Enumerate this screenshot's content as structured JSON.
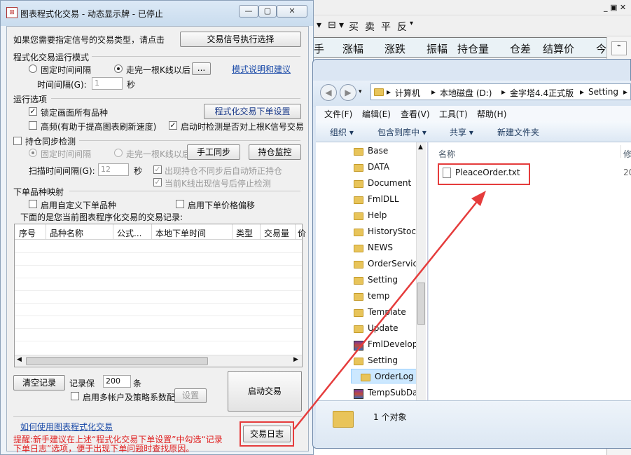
{
  "background_app": {
    "toolbar_items": [
      "买",
      "卖",
      "平",
      "反"
    ],
    "header_columns": [
      "手",
      "涨幅",
      "涨跌",
      "振幅",
      "持仓量",
      "仓差",
      "结算价",
      "今"
    ]
  },
  "main_window": {
    "title": "图表程式化交易 - 动态显示牌 - 已停止",
    "signal_prompt": "如果您需要指定信号的交易类型，请点击",
    "signal_button": "交易信号执行选择",
    "run_mode": {
      "label": "程式化交易运行模式",
      "fixed_interval": "固定时间间隔",
      "after_kline": "走完一根K线以后",
      "ellipsis_button": "...",
      "help_link": "模式说明和建议",
      "interval_label": "时间间隔(G):",
      "interval_value": "1",
      "interval_unit": "秒"
    },
    "run_options": {
      "label": "运行选项",
      "lock_all": "锁定画面所有品种",
      "order_settings_button": "程式化交易下单设置",
      "high_freq": "高频(有助于提高图表刷新速度)",
      "startup_check": "启动时检测是否对上根K信号交易"
    },
    "position_sync": {
      "label": "持仓同步检测",
      "fixed_interval": "固定时间间隔",
      "after_kline": "走完一根K线以后",
      "manual_sync_button": "手工同步",
      "monitor_button": "持仓监控",
      "scan_label": "扫描时间间隔(G):",
      "scan_value": "12",
      "scan_unit": "秒",
      "auto_fix": "出现持仓不同步后自动矫正持仓",
      "stop_check": "当前K线出现信号后停止检测"
    },
    "order_mapping": {
      "label": "下单品种映射",
      "custom_symbol": "启用自定义下单品种",
      "price_offset": "启用下单价格偏移"
    },
    "records_caption": "下面的是您当前图表程序化交易的交易记录:",
    "table_columns": [
      "序号",
      "品种名称",
      "公式...",
      "本地下单时间",
      "类型",
      "交易量",
      "价"
    ],
    "clear_button": "清空记录",
    "keep_label": "记录保",
    "keep_value": "200",
    "keep_unit": "条",
    "multi_account": "启用多帐户及策略系数配",
    "settings_button": "设置",
    "start_button": "启动交易",
    "howto_link": "如何使用图表程式化交易",
    "log_button": "交易日志",
    "tip_line1": "提醒:新手建议在上述“程式化交易下单设置”中勾选“记录",
    "tip_line2": "下单日志”选项，便于出现下单问题时查找原因。"
  },
  "explorer": {
    "path": [
      "计算机",
      "本地磁盘 (D:)",
      "金字塔4.4正式版",
      "Setting"
    ],
    "menu": [
      "文件(F)",
      "编辑(E)",
      "查看(V)",
      "工具(T)",
      "帮助(H)"
    ],
    "commands": [
      "组织 ▾",
      "包含到库中 ▾",
      "共享 ▾",
      "新建文件夹"
    ],
    "tree": [
      "Base",
      "DATA",
      "Document",
      "FmlDLL",
      "Help",
      "HistoryStock",
      "NEWS",
      "OrderService",
      "Setting",
      "temp",
      "Template",
      "Update",
      "FmlDevelop",
      "Setting",
      "OrderLog",
      "TempSubDa"
    ],
    "column_name": "名称",
    "column_modified": "修",
    "file": "PleaceOrder.txt",
    "file_date_fragment": "20",
    "status": "1 个对象"
  },
  "colors": {
    "highlight": "#e53c3c",
    "link": "#1a4aa8"
  }
}
